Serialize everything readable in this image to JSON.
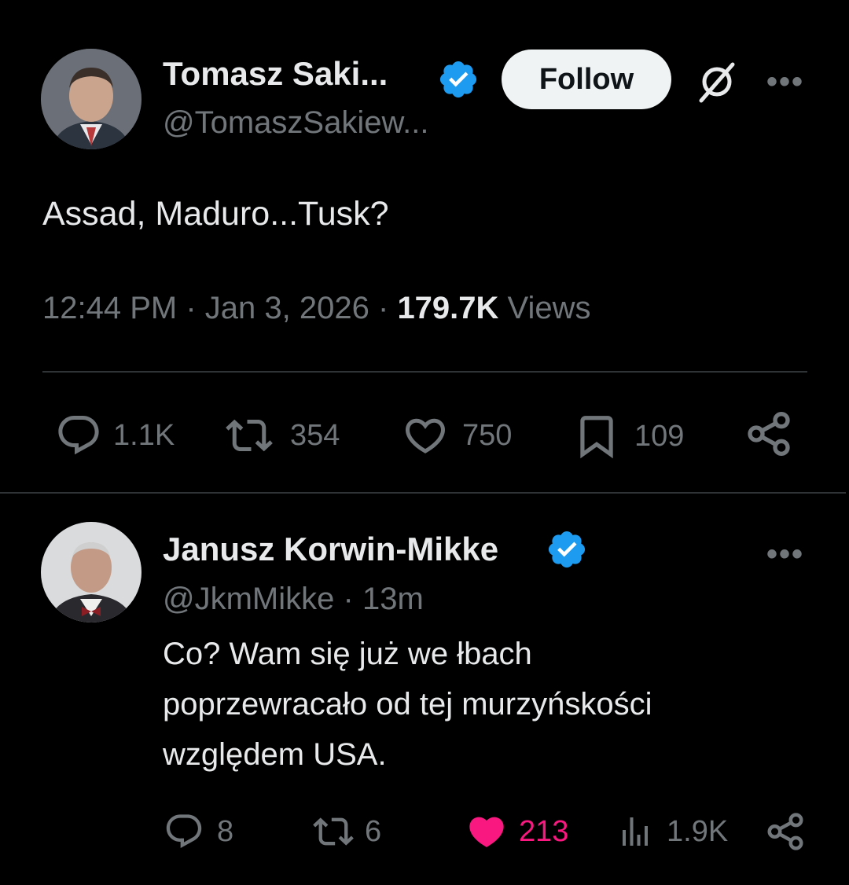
{
  "main_tweet": {
    "author_name": "Tomasz Saki...",
    "author_handle": "@TomaszSakiew...",
    "follow_label": "Follow",
    "more_label": "•••",
    "text": "Assad, Maduro...Tusk?",
    "time": "12:44 PM",
    "date": "Jan 3, 2026",
    "sep": "·",
    "views_count": "179.7K",
    "views_label": "Views",
    "actions": {
      "replies": "1.1K",
      "reposts": "354",
      "likes": "750",
      "bookmarks": "109"
    },
    "icons": [
      "verified-badge",
      "grok-icon",
      "more-icon",
      "reply-icon",
      "repost-icon",
      "like-icon",
      "bookmark-icon",
      "share-icon"
    ]
  },
  "reply_tweet": {
    "author_name": "Janusz Korwin-Mikke",
    "author_handle": "@JkmMikke",
    "time_ago": "· 13m",
    "more_label": "•••",
    "text_lines": [
      "Co? Wam się już we łbach",
      "poprzewracało od tej murzyńskości",
      "względem USA."
    ],
    "actions": {
      "replies": "8",
      "reposts": "6",
      "likes": "213",
      "views": "1.9K"
    },
    "liked": true
  },
  "colors": {
    "background": "#000000",
    "text": "#e7e9ea",
    "secondary": "#71767b",
    "verified": "#1d9bf0",
    "like_active": "#f91880",
    "divider": "#2f3336"
  }
}
